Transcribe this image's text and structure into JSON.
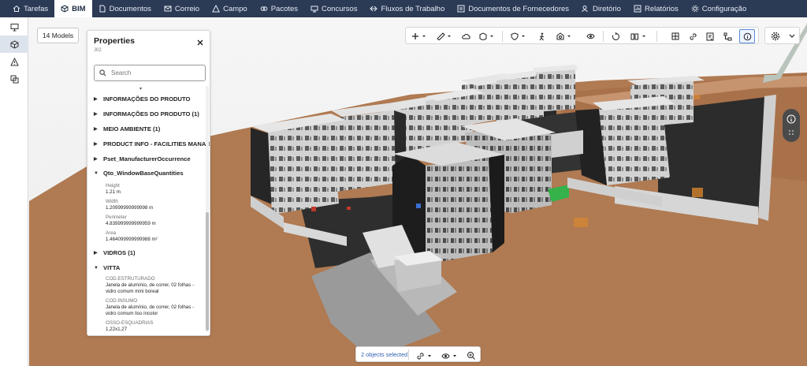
{
  "nav": {
    "items": [
      {
        "label": "Tarefas",
        "icon": "home-icon"
      },
      {
        "label": "BIM",
        "icon": "cube-icon",
        "active": true
      },
      {
        "label": "Documentos",
        "icon": "document-icon"
      },
      {
        "label": "Correio",
        "icon": "mail-icon"
      },
      {
        "label": "Campo",
        "icon": "warning-icon"
      },
      {
        "label": "Pacotes",
        "icon": "packages-icon"
      },
      {
        "label": "Concursos",
        "icon": "tenders-icon"
      },
      {
        "label": "Fluxos de Trabalho",
        "icon": "workflow-icon"
      },
      {
        "label": "Documentos de Fornecedores",
        "icon": "supplier-docs-icon"
      },
      {
        "label": "Diretório",
        "icon": "directory-icon"
      },
      {
        "label": "Relatórios",
        "icon": "reports-icon"
      },
      {
        "label": "Configuração",
        "icon": "gear-icon"
      }
    ],
    "bg_color": "#2b3a55"
  },
  "rail": {
    "items": [
      {
        "icon": "presentation-icon"
      },
      {
        "icon": "cube-icon",
        "active": true
      },
      {
        "icon": "warning-icon"
      },
      {
        "icon": "layers-icon"
      }
    ]
  },
  "models_button": {
    "label": "14 Models"
  },
  "properties": {
    "title": "Properties",
    "subtitle": "J02",
    "search_placeholder": "Search",
    "groups": {
      "g1": {
        "label": "INFORMAÇÕES DO PRODUTO",
        "expanded": false
      },
      "g2": {
        "label": "INFORMAÇÕES DO PRODUTO (1)",
        "expanded": false
      },
      "g3": {
        "label": "MEIO AMBIENTE (1)",
        "expanded": false
      },
      "g4": {
        "label": "PRODUCT INFO - FACILITIES MANAG",
        "expanded": false
      },
      "g5": {
        "label": "Pset_ManufacturerOccurrence",
        "expanded": false
      },
      "g6": {
        "label": "Qto_WindowBaseQuantities",
        "expanded": true
      },
      "g7": {
        "label": "VIDROS (1)",
        "expanded": false
      },
      "g8": {
        "label": "VITTA",
        "expanded": true
      }
    },
    "qto": {
      "height_label": "Height",
      "height_value": "1.21 m",
      "width_label": "Width",
      "width_value": "1.20999999999998 m",
      "perimeter_label": "Perimeter",
      "perimeter_value": "4.839999999999959 m",
      "area_label": "Area",
      "area_value": "1.464099999999988 m²"
    },
    "vitta": {
      "p1_label": "COD.ESTRUTURADO",
      "p1_value_l1": "Janela de alumínio, de correr, 02 folhas -",
      "p1_value_l2": "vidro comum mini boreal",
      "p2_label": "COD.INSUMO",
      "p2_value_l1": "Janela de alumínio, de correr, 02 folhas -",
      "p2_value_l2": "vidro comum liso incolor",
      "p3_label": "OSSO-ESQUADRIAS",
      "p3_value": "1,22x1,27"
    }
  },
  "toolbar": {
    "tools": [
      {
        "icon": "add-icon",
        "dropdown": true
      },
      {
        "icon": "measure-icon",
        "dropdown": true
      },
      {
        "icon": "cloud-markup-icon"
      },
      {
        "icon": "section-box-icon",
        "dropdown": true
      },
      {
        "icon": "shield-icon",
        "dropdown": true
      },
      {
        "icon": "walk-icon"
      },
      {
        "icon": "camera-view-icon",
        "dropdown": true
      },
      {
        "icon": "eye-icon"
      },
      {
        "icon": "reset-view-icon"
      },
      {
        "icon": "binoculars-icon",
        "dropdown": true
      },
      {
        "icon": "grid-icon"
      },
      {
        "icon": "link-icon"
      },
      {
        "icon": "clash-report-icon"
      },
      {
        "icon": "hierarchy-icon"
      },
      {
        "icon": "info-icon",
        "selected": true
      }
    ],
    "settings_icon": "settings-icon"
  },
  "bottom_bar": {
    "selection_text": "2 objects selected",
    "tools": [
      {
        "icon": "link-icon",
        "dropdown": true
      },
      {
        "icon": "eye-icon",
        "dropdown": true
      },
      {
        "icon": "zoom-to-icon"
      }
    ]
  },
  "colors": {
    "accent": "#5b8ad6",
    "selection_text": "#2f5fb0",
    "ground": "#b07a52",
    "building_wall": "#d4d4d4",
    "building_dark": "#2a2a2a"
  }
}
